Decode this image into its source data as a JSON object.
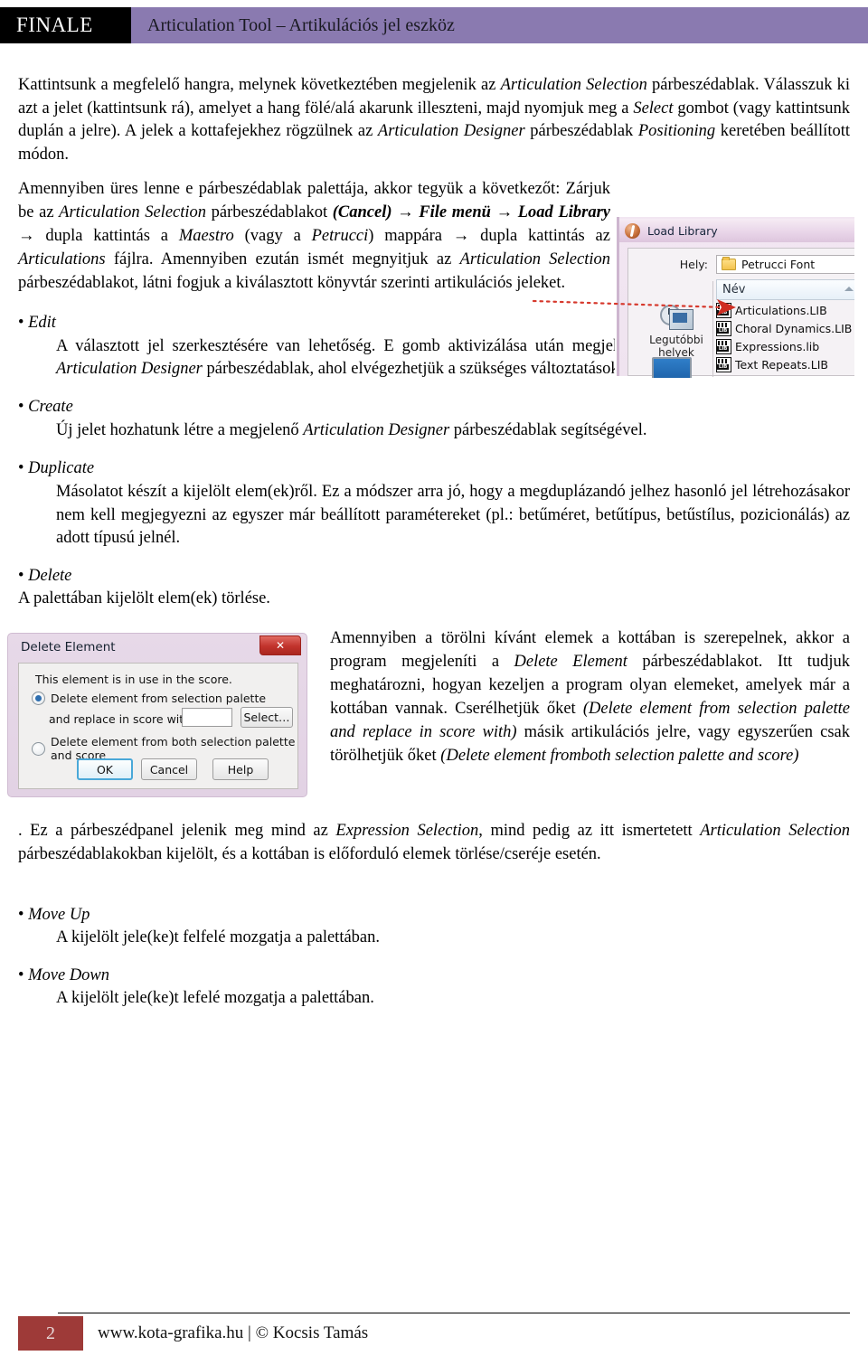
{
  "header": {
    "brand": "FINALE",
    "title": "Articulation Tool – Artikulációs jel eszköz",
    "brand_bg": "#000000",
    "bar_bg": "#8a7ab0"
  },
  "intro": {
    "p1_a": "Kattintsunk a megfelelő hangra, melynek következtében megjelenik az ",
    "p1_i1": "Articulation Selection",
    "p1_b": " párbeszédablak. Válasszuk ki azt a jelet (kattintsunk rá), amelyet a hang fölé/alá akarunk illeszteni, majd nyomjuk meg a ",
    "p1_i2": "Select",
    "p1_c": " gombot (vagy kattintsunk duplán a jelre). A jelek a kottafejekhez rögzülnek az ",
    "p1_i3": "Articulation Designer",
    "p1_d": " párbeszédablak ",
    "p1_i4": "Positioning",
    "p1_e": " keretében beállított módon."
  },
  "library_para": {
    "a": "Amennyiben üres lenne e párbeszédablak palettája, akkor tegyük a következőt: Zárjuk be az ",
    "i1": "Articulation Selection",
    "b": " párbeszédablakot ",
    "s1": "(Cancel)",
    "arrow1": " → ",
    "s2": "File menü",
    "arrow2": " → ",
    "s3": "Load Library",
    "arrow3": " → ",
    "s4_plain": "dupla kattintás a ",
    "s5": "Maestro",
    "c": " (vagy a ",
    "i2": "Petrucci",
    "d": ") mappára ",
    "arrow4": " → ",
    "e": " dupla kattintás az ",
    "i3": "Articulations",
    "f": " fájlra. Amennyiben ezután ismét megnyitjuk az ",
    "i4": "Articulation Selection",
    "g": " párbeszédablakot, látni fogjuk a kiválasztott könyvtár szerinti artikulációs jeleket."
  },
  "load_library_dialog": {
    "title": "Load Library",
    "app_icon": "finale-app-icon",
    "location_label": "Hely:",
    "location_value": "Petrucci Font",
    "column_header": "Név",
    "files": [
      "Articulations.LIB",
      "Choral Dynamics.LIB",
      "Expressions.lib",
      "Text Repeats.LIB"
    ],
    "sidebar_recent": "Legutióbbi helyek",
    "sidebar_recent_line1": "Legutóbbi",
    "sidebar_recent_line2": "helyek"
  },
  "bullets": [
    {
      "dot": "• ",
      "label": "Edit",
      "body_parts": {
        "a": "A választott jel szerkesztésére van lehetőség. E gomb aktivizálása után megjelenik a következőkben ismertetett ",
        "i1": "Articulation Designer",
        "b": " párbeszédablak, ahol elvégezhetjük a szükséges változtatásokat."
      }
    },
    {
      "dot": "• ",
      "label": "Create",
      "body_parts": {
        "a": "Új jelet hozhatunk létre a megjelenő ",
        "i1": "Articulation Designer",
        "b": " párbeszédablak segítségével."
      }
    },
    {
      "dot": "• ",
      "label": "Duplicate",
      "body_parts": {
        "a": "Másolatot készít a kijelölt elem(ek)ről. Ez a módszer arra jó, hogy a megduplázandó jelhez hasonló jel létrehozásakor nem kell megjegyezni az egyszer már beállított paramétereket (pl.: betűméret, betűtípus, betűstílus, pozicionálás) az adott típusú jelnél.",
        "i1": "",
        "b": ""
      }
    }
  ],
  "delete_section": {
    "dot": "• ",
    "label": "Delete",
    "short_desc": "A palettában kijelölt elem(ek) törlése.",
    "wrap_a": "Amennyiben a törölni kívánt elemek a kottában is szerepelnek, akkor a program megjeleníti a ",
    "wrap_i1": "Delete Element",
    "wrap_b": " párbeszédablakot. Itt tudjuk meghatározni, hogyan kezeljen a program olyan elemeket, amelyek már a kottában vannak. Cserélhetjük őket ",
    "wrap_i2": "(Delete element from selection palette and replace in score with)",
    "wrap_c": " másik artikulációs jelre, vagy egyszerűen csak törölhetjük őket ",
    "wrap_i3": "(Delete element fromboth selection palette and score)",
    "wrap_d": ". Ez a párbeszédpanel jelenik meg mind az ",
    "wrap_i4": "Expression Selection",
    "wrap_e": ", mind pedig az itt ismertetett ",
    "wrap_i5": "Articulation Selection",
    "wrap_f": " párbeszédablakokban kijelölt, és a kottában is előforduló elemek törlése/cseréje esetén."
  },
  "delete_dialog": {
    "title": "Delete Element",
    "close_label": "✕",
    "message": "This element is in use in the score.",
    "option1": "Delete element from selection palette",
    "option1_selected": true,
    "replace_label": "and replace in score with:",
    "replace_value": "",
    "select_button": "Select…",
    "option2": "Delete element from both selection palette and score",
    "option2_selected": false,
    "ok_button": "OK",
    "cancel_button": "Cancel",
    "help_button": "Help"
  },
  "move_bullets": [
    {
      "dot": "• ",
      "label": "Move Up",
      "body": "A kijelölt jele(ke)t felfelé mozgatja a palettában."
    },
    {
      "dot": "• ",
      "label": "Move Down",
      "body": "A kijelölt jele(ke)t lefelé mozgatja a palettában."
    }
  ],
  "footer": {
    "page_number": "2",
    "text": "www.kota-grafika.hu | © Kocsis Tamás",
    "box_color": "#9e3a38"
  }
}
